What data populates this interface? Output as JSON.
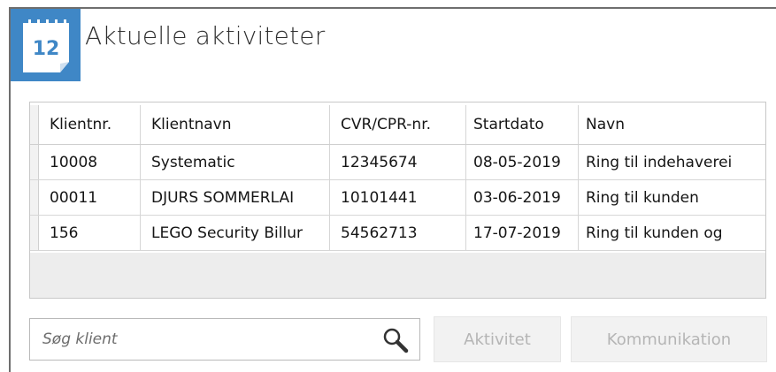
{
  "header": {
    "title": "Aktuelle aktiviteter",
    "calendar_icon": "calendar-12-icon",
    "calendar_day": "12"
  },
  "table": {
    "columns": [
      "Klientnr.",
      "Klientnavn",
      "CVR/CPR-nr.",
      "Startdato",
      "Navn"
    ],
    "rows": [
      [
        "10008",
        "Systematic",
        "12345674",
        "08-05-2019",
        "Ring til indehaverei"
      ],
      [
        "00011",
        "DJURS SOMMERLAI",
        "10101441",
        "03-06-2019",
        "Ring til kunden"
      ],
      [
        "156",
        "LEGO Security Billur",
        "54562713",
        "17-07-2019",
        "Ring til kunden og"
      ]
    ]
  },
  "search": {
    "placeholder": "Søg klient",
    "value": "",
    "icon": "magnifier-icon"
  },
  "buttons": {
    "aktivitet": "Aktivitet",
    "kommunikation": "Kommunikation"
  },
  "colors": {
    "accent": "#3f87c6",
    "disabled_text": "#b5b5b5",
    "grid_border": "#d6d6d6"
  }
}
